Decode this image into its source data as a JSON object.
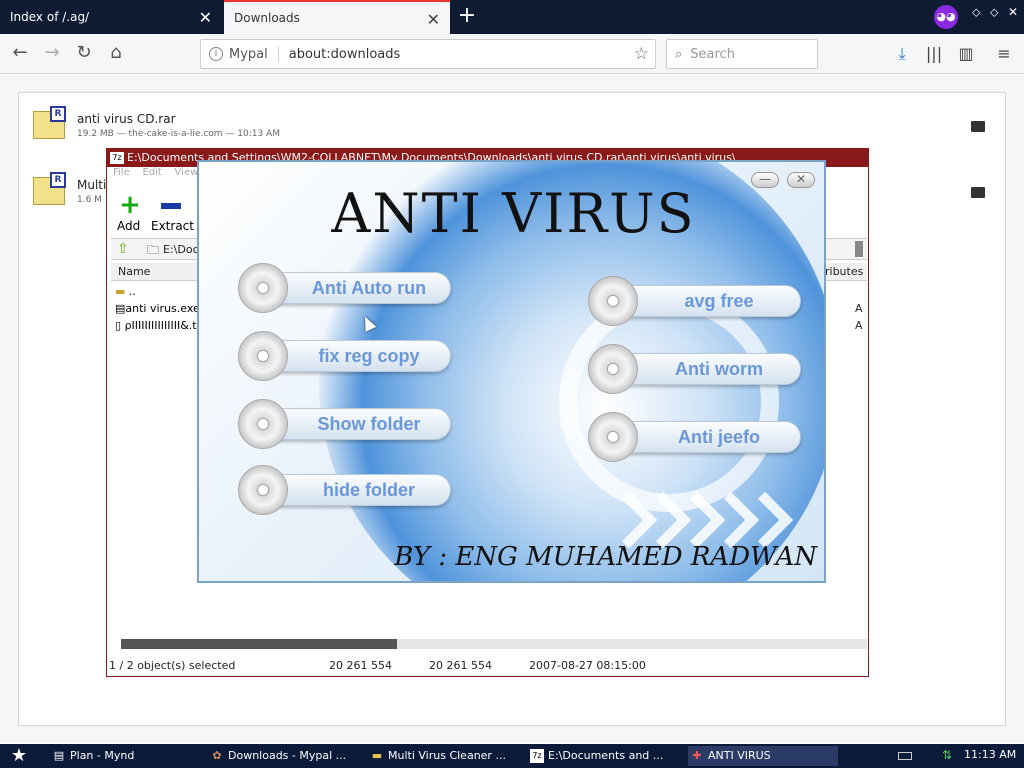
{
  "browser": {
    "tabs": [
      {
        "label": "Index of /.ag/"
      },
      {
        "label": "Downloads"
      }
    ],
    "url_prefix": "Mypal",
    "url": "about:downloads",
    "search_placeholder": "Search"
  },
  "downloads": [
    {
      "name": "anti virus CD.rar",
      "meta": "19.2 MB — the-cake-is-a-lie.com — 10:13 AM",
      "icon_letter": "R"
    },
    {
      "name": "Multi V",
      "meta": "1.6 M",
      "icon_letter": "R"
    }
  ],
  "zip": {
    "title": "E:\\Documents and Settings\\WM2-COLLABNET\\My Documents\\Downloads\\anti virus CD.rar\\anti virus\\anti virus\\",
    "icon_label": "7z",
    "menu": [
      "File",
      "Edit",
      "View"
    ],
    "add_label": "Add",
    "extract_label": "Extract",
    "path": "E:\\Docu",
    "col_name": "Name",
    "col_attributes": "ributes",
    "rows": [
      {
        "name": "..",
        "attr": ""
      },
      {
        "name": "anti virus.exe",
        "attr": "A"
      },
      {
        "name": "ρΙΙΙΙΙΙΙΙΙΙΙΙΙΙΙ&.tx",
        "attr": "A"
      }
    ],
    "status": {
      "selected": "1 / 2 object(s) selected",
      "size": "20 261 554",
      "packed": "20 261 554",
      "modified": "2007-08-27 08:15:00"
    },
    "scroll_fraction": 0.37
  },
  "antivirus": {
    "title": "ANTI VIRUS",
    "min_label": "—",
    "close_label": "✕",
    "buttons_left": [
      "Anti Auto run",
      "fix reg copy",
      "Show folder",
      "hide folder"
    ],
    "buttons_right": [
      "avg free",
      "Anti worm",
      "Anti jeefo"
    ],
    "author": "BY : ENG MUHAMED RADWAN"
  },
  "taskbar": {
    "tasks": [
      {
        "label": "Plan - Mynd",
        "icon": "doc-icon"
      },
      {
        "label": "Downloads - Mypal ...",
        "icon": "mypal-icon"
      },
      {
        "label": "Multi Virus Cleaner ...",
        "icon": "folder-icon"
      },
      {
        "label": "E:\\Documents and ...",
        "icon": "7z-icon"
      },
      {
        "label": "ANTI VIRUS",
        "icon": "antivirus-icon"
      }
    ],
    "clock": "11:13 AM"
  },
  "colors": {
    "tabstrip": "#0e1b33",
    "zip_title": "#8a1a1a",
    "av_button_text": "#6b97d9",
    "taskbar": "#0c1a3a"
  }
}
